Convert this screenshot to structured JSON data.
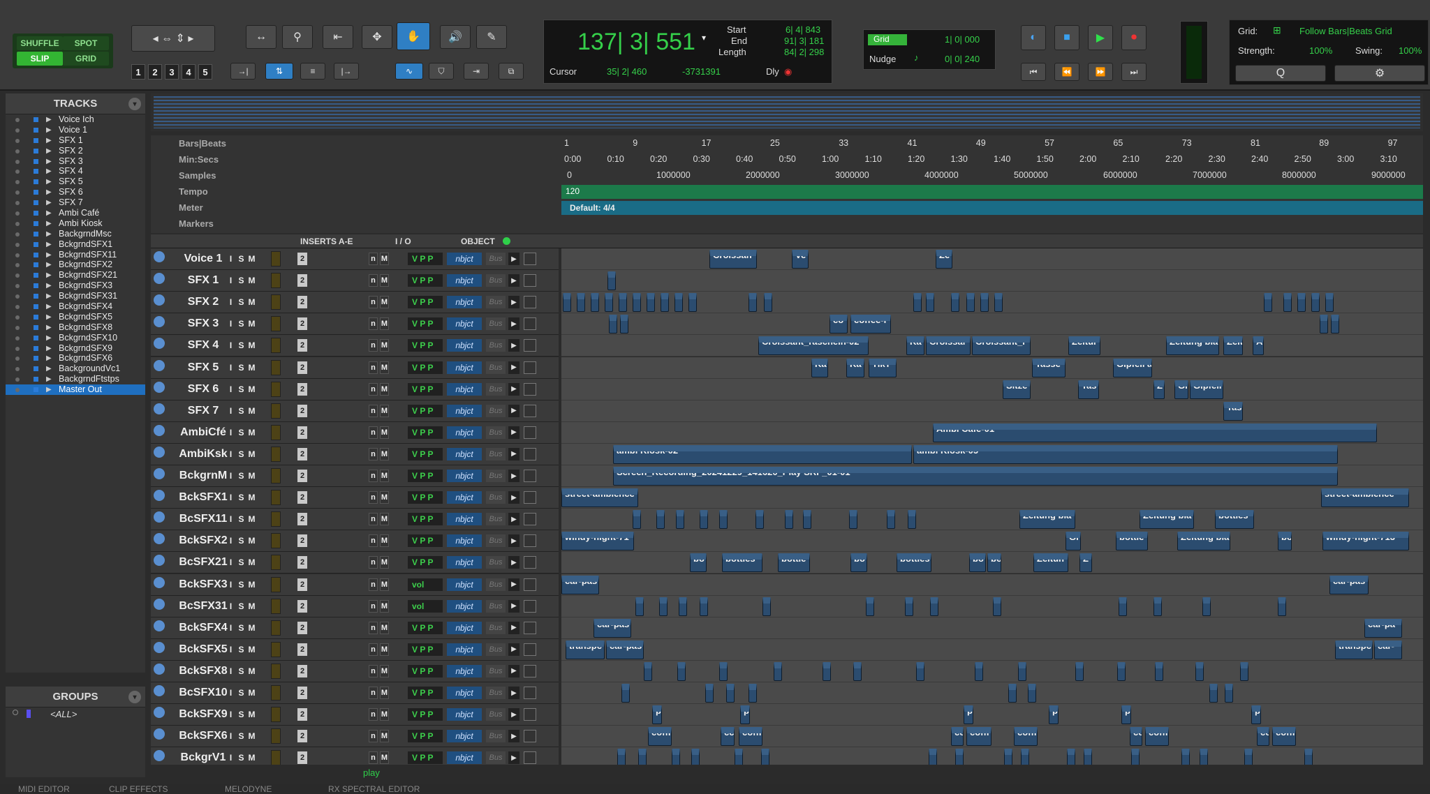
{
  "toolbar": {
    "edit_modes": [
      "SHUFFLE",
      "SPOT",
      "SLIP",
      "GRID"
    ],
    "zoom_presets": [
      "1",
      "2",
      "3",
      "4",
      "5"
    ],
    "main_counter": "137| 3| 551",
    "start_label": "Start",
    "start_value": "6| 4| 843",
    "end_label": "End",
    "end_value": "91| 3| 181",
    "length_label": "Length",
    "length_value": "84| 2| 298",
    "cursor_label": "Cursor",
    "cursor_value": "35| 2| 460",
    "cursor_sample": "-3731391",
    "dly_label": "Dly",
    "grid_label": "Grid",
    "grid_value": "1| 0| 000",
    "nudge_label": "Nudge",
    "nudge_value": "0| 0| 240",
    "grid_mode_label": "Grid:",
    "grid_mode_value": "Follow Bars|Beats Grid",
    "strength_label": "Strength:",
    "strength_value": "100%",
    "swing_label": "Swing:",
    "swing_value": "100%"
  },
  "tracks_panel": {
    "title": "TRACKS",
    "items": [
      "Voice Ich",
      "Voice 1",
      "SFX 1",
      "SFX 2",
      "SFX 3",
      "SFX 4",
      "SFX 5",
      "SFX 6",
      "SFX 7",
      "Ambi Café",
      "Ambi Kiosk",
      "BackgrndMsc",
      "BckgrndSFX1",
      "BckgrndSFX11",
      "BckgrndSFX2",
      "BckgrndSFX21",
      "BckgrndSFX3",
      "BckgrndSFX31",
      "BckgrndSFX4",
      "BckgrndSFX5",
      "BckgrndSFX8",
      "BckgrndSFX10",
      "BckgrndSFX9",
      "BckgrndSFX6",
      "BackgroundVc1",
      "BackgrndFtstps",
      "Master Out"
    ]
  },
  "groups_panel": {
    "title": "GROUPS",
    "item": "<ALL>"
  },
  "rulers": {
    "bars_label": "Bars|Beats",
    "bars_ticks": [
      "1",
      "9",
      "17",
      "25",
      "33",
      "41",
      "49",
      "57",
      "65",
      "73",
      "81",
      "89",
      "97"
    ],
    "min_label": "Min:Secs",
    "min_ticks": [
      "0:00",
      "0:10",
      "0:20",
      "0:30",
      "0:40",
      "0:50",
      "1:00",
      "1:10",
      "1:20",
      "1:30",
      "1:40",
      "1:50",
      "2:00",
      "2:10",
      "2:20",
      "2:30",
      "2:40",
      "2:50",
      "3:00",
      "3:10"
    ],
    "samples_label": "Samples",
    "samples_ticks": [
      "0",
      "1000000",
      "2000000",
      "3000000",
      "4000000",
      "5000000",
      "6000000",
      "7000000",
      "8000000",
      "9000000"
    ],
    "tempo_label": "Tempo",
    "tempo_value": "120",
    "meter_label": "Meter",
    "meter_value": "Default: 4/4",
    "markers_label": "Markers"
  },
  "columns": {
    "inserts": "INSERTS A-E",
    "io": "I / O",
    "object": "OBJECT"
  },
  "track_rows": [
    {
      "name": "Voice 1",
      "vol": false
    },
    {
      "name": "SFX 1",
      "vol": false
    },
    {
      "name": "SFX 2",
      "vol": false
    },
    {
      "name": "SFX 3",
      "vol": false
    },
    {
      "name": "SFX 4",
      "vol": false
    },
    {
      "name": "SFX 5",
      "vol": false
    },
    {
      "name": "SFX 6",
      "vol": false
    },
    {
      "name": "SFX 7",
      "vol": false
    },
    {
      "name": "AmbiCfé",
      "vol": false
    },
    {
      "name": "AmbiKsk",
      "vol": false
    },
    {
      "name": "BckgrnM",
      "vol": false
    },
    {
      "name": "BckSFX1",
      "vol": false
    },
    {
      "name": "BcSFX11",
      "vol": false
    },
    {
      "name": "BckSFX2",
      "vol": false
    },
    {
      "name": "BcSFX21",
      "vol": false
    },
    {
      "name": "BckSFX3",
      "vol": true
    },
    {
      "name": "BcSFX31",
      "vol": true
    },
    {
      "name": "BckSFX4",
      "vol": false
    },
    {
      "name": "BckSFX5",
      "vol": false
    },
    {
      "name": "BckSFX8",
      "vol": false
    },
    {
      "name": "BcSFX10",
      "vol": false
    },
    {
      "name": "BckSFX9",
      "vol": false
    },
    {
      "name": "BckSFX6",
      "vol": false
    },
    {
      "name": "BckgrV1",
      "vol": false
    }
  ],
  "track_labels": {
    "ism": [
      "I",
      "S",
      "M"
    ],
    "io": [
      "n",
      "M"
    ],
    "vpp": "V P P",
    "vol": "vol",
    "object": "nbjct",
    "bus": "Bus",
    "insert_num": "2"
  },
  "clips": [
    {
      "row": 0,
      "items": [
        [
          "Croissan",
          1016,
          1084
        ],
        [
          "Ve",
          1134,
          1158
        ],
        [
          "Ze",
          1340,
          1364
        ]
      ]
    },
    {
      "row": 3,
      "items": [
        [
          "co",
          1188,
          1214
        ],
        [
          "coffee-r",
          1218,
          1276
        ]
      ]
    },
    {
      "row": 4,
      "items": [
        [
          "Croissant_rascheln-02",
          1086,
          1244
        ],
        [
          "Ka",
          1298,
          1324
        ],
        [
          "Croissar",
          1326,
          1390
        ],
        [
          "Croissant_r",
          1392,
          1476
        ],
        [
          "Zeitur",
          1530,
          1576
        ],
        [
          "Zeitung blä",
          1670,
          1746
        ],
        [
          "Zeit",
          1752,
          1780
        ],
        [
          "A",
          1794,
          1810
        ]
      ]
    },
    {
      "row": 5,
      "items": [
        [
          "Ka",
          1162,
          1186
        ],
        [
          "Ka",
          1212,
          1238
        ],
        [
          "TikT",
          1244,
          1284
        ],
        [
          "Tasse",
          1478,
          1526
        ],
        [
          "Gipfeli a",
          1594,
          1650
        ]
      ]
    },
    {
      "row": 6,
      "items": [
        [
          "Sitze",
          1436,
          1476
        ],
        [
          "Tas",
          1544,
          1574
        ],
        [
          "Z",
          1652,
          1668
        ],
        [
          "Gi",
          1682,
          1702
        ],
        [
          "Gipfeli",
          1704,
          1752
        ]
      ]
    },
    {
      "row": 7,
      "items": [
        [
          "Tas",
          1752,
          1780
        ]
      ]
    },
    {
      "row": 8,
      "items": [
        [
          "Ambi Cafe-01",
          1336,
          1972
        ]
      ]
    },
    {
      "row": 9,
      "items": [
        [
          "ambi Kiosk-02",
          878,
          1306
        ],
        [
          "ambi Kiosk-05",
          1308,
          1916
        ]
      ]
    },
    {
      "row": 10,
      "items": [
        [
          "Screen_Recording_20241229_141620_Play SRF_01-01",
          878,
          1916
        ]
      ]
    },
    {
      "row": 11,
      "items": [
        [
          "street-ambience",
          804,
          914
        ],
        [
          "street-ambience",
          1892,
          2018
        ]
      ]
    },
    {
      "row": 12,
      "items": [
        [
          "Zeitung blä",
          1460,
          1540
        ],
        [
          "Zeitung blä",
          1632,
          1710
        ],
        [
          "bottles",
          1740,
          1796
        ]
      ]
    },
    {
      "row": 13,
      "items": [
        [
          "windy-night-71",
          804,
          908
        ],
        [
          "Gi",
          1526,
          1548
        ],
        [
          "bottle",
          1598,
          1644
        ],
        [
          "Zeitung blä",
          1686,
          1762
        ],
        [
          "bo",
          1830,
          1850
        ],
        [
          "windy-night-713",
          1894,
          2018
        ]
      ]
    },
    {
      "row": 14,
      "items": [
        [
          "bo",
          988,
          1012
        ],
        [
          "bottles",
          1034,
          1092
        ],
        [
          "bottle",
          1114,
          1160
        ],
        [
          "bo",
          1218,
          1242
        ],
        [
          "bottles",
          1284,
          1334
        ],
        [
          "bo",
          1388,
          1412
        ],
        [
          "bo",
          1414,
          1434
        ],
        [
          "Zeitun",
          1480,
          1530
        ],
        [
          "Z",
          1546,
          1564
        ]
      ]
    },
    {
      "row": 15,
      "items": [
        [
          "car-pas",
          804,
          858
        ],
        [
          "car-pas",
          1904,
          1960
        ]
      ]
    },
    {
      "row": 17,
      "items": [
        [
          "car-pas",
          850,
          904
        ],
        [
          "car-pa",
          1954,
          2008
        ]
      ]
    },
    {
      "row": 18,
      "items": [
        [
          "transpc",
          810,
          866
        ],
        [
          "car-pas",
          868,
          922
        ],
        [
          "transpc",
          1912,
          1966
        ],
        [
          "car-",
          1968,
          2008
        ]
      ]
    },
    {
      "row": 21,
      "items": [
        [
          "p",
          934,
          948
        ],
        [
          "p",
          1060,
          1074
        ],
        [
          "p",
          1380,
          1394
        ],
        [
          "p",
          1502,
          1516
        ],
        [
          "p",
          1606,
          1620
        ],
        [
          "p",
          1792,
          1806
        ]
      ]
    },
    {
      "row": 22,
      "items": [
        [
          "coffi",
          928,
          962
        ],
        [
          "cc",
          1032,
          1052
        ],
        [
          "coffi",
          1058,
          1092
        ],
        [
          "cc",
          1362,
          1380
        ],
        [
          "coffi",
          1384,
          1420
        ],
        [
          "coffi",
          1452,
          1486
        ],
        [
          "cc",
          1618,
          1636
        ],
        [
          "coffi",
          1640,
          1674
        ],
        [
          "cc",
          1800,
          1818
        ],
        [
          "coffi",
          1822,
          1856
        ]
      ]
    }
  ],
  "footer": {
    "tabs": [
      "MIDI EDITOR",
      "CLIP EFFECTS",
      "MELODYNE",
      "RX SPECTRAL EDITOR"
    ],
    "play_label": "play"
  }
}
